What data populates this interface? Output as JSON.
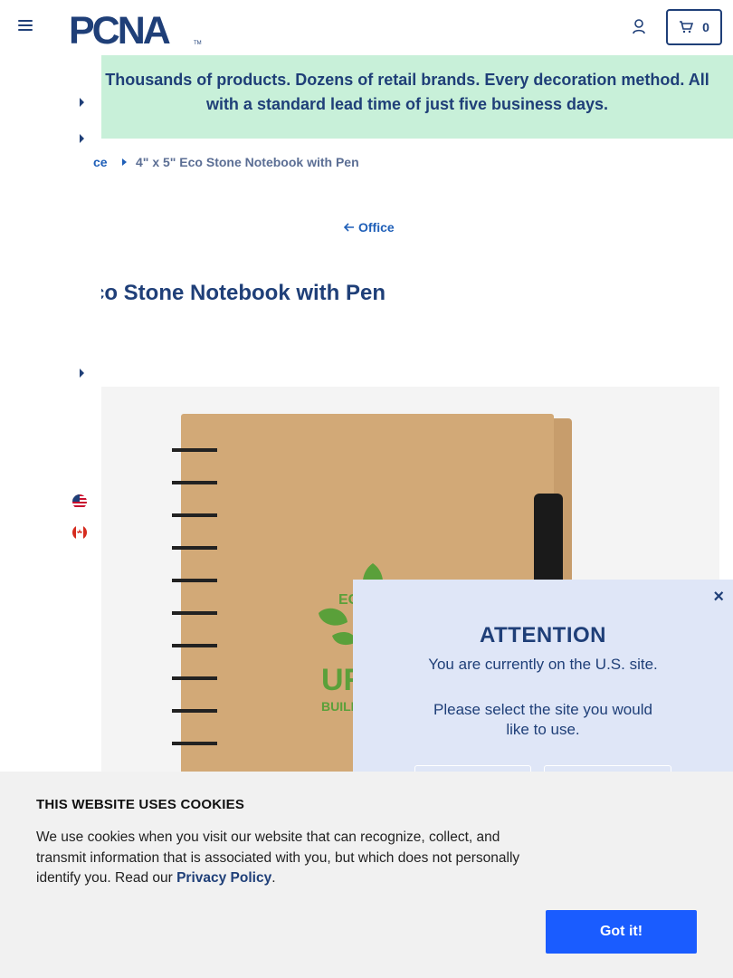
{
  "header": {
    "logo_alt": "PCNA",
    "cart_count": "0"
  },
  "promo": {
    "text_line1": "Thousands of products. Dozens of retail brands. Every decoration method. All",
    "text_line2": "with a standard lead time of just five business days."
  },
  "breadcrumb": {
    "parent": "ce",
    "current": "4\" x 5\" Eco Stone Notebook with Pen"
  },
  "back_link": {
    "label": "Office"
  },
  "product": {
    "title": "co Stone Notebook with Pen",
    "image_alt": "Eco Stone Notebook with Pen"
  },
  "modal": {
    "title": "ATTENTION",
    "line1": "You are currently on the U.S. site.",
    "line2": "Please select the site you would like to use.",
    "close_label": "×"
  },
  "cookie": {
    "title": "THIS WEBSITE USES COOKIES",
    "body_prefix": "We use cookies when you visit our website that can recognize, collect, and transmit information that is associated with you, but which does not personally identify you. Read our ",
    "link_label": "Privacy Policy",
    "body_suffix": ".",
    "button_label": "Got it!"
  },
  "colors": {
    "brand_navy": "#1f3f78",
    "link_blue": "#1f5fb8",
    "promo_green": "#c8f0d9",
    "modal_bg": "#dfe6f7",
    "cookie_button": "#1a5cff"
  }
}
